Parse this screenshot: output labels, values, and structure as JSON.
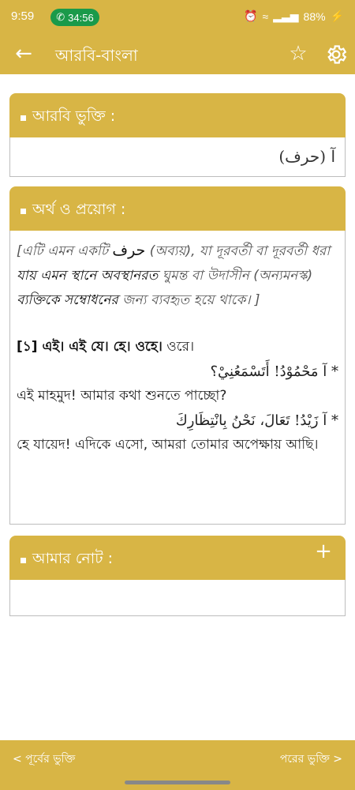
{
  "status": {
    "time": "9:59",
    "call_time": "34:56",
    "battery": "88%"
  },
  "appbar": {
    "title": "আরবি-বাংলা",
    "back_icon": "arrow-left",
    "star_icon": "star-outline",
    "settings_icon": "gear"
  },
  "arabic_card": {
    "header": "আরবি ভুক্তি :",
    "word": "آ (حرف)"
  },
  "meaning_card": {
    "header": "অর্থ ও প্রয়োগ :",
    "intro_prefix": "[এটি এমন একটি ",
    "intro_arabic": "حرف",
    "intro_mid1": " (অব্যয়), যা দূরবর্তী বা দূরবর্তী ধরা ",
    "intro_bold1": "যায় এমন স্থানে অবস্থানরত",
    "intro_mid2": " ঘুমন্ত বা উদাসীন (অন্যমনস্ক) ",
    "intro_bold2": "ব্যক্তিকে সম্বোধনের",
    "intro_suffix": " জন্য ব্যবহৃত হয়ে থাকে। ]",
    "line1_a": "[১] এই। এই যে। হে। ",
    "line1_bold": "ওহে।",
    "line1_b": " ওরে।",
    "ex1_ar": "* آ مَحْمُوْدُ! أَتَسْمَعُنِيْ؟",
    "ex1_bn": "এই মাহমুদ! আমার কথা শুনতে পাচ্ছো?",
    "ex2_ar": "* آ زَيْدُ! تَعَالَ، نَحْنُ بِانْتِظَارِكَ",
    "ex2_bn": "হে যায়েদ! এদিকে এসো, আমরা তোমার অপেক্ষায় আছি।"
  },
  "notes_card": {
    "header": "আমার নোট :",
    "add_icon": "plus"
  },
  "bottombar": {
    "prev_label": "< পূর্বের ভুক্তি",
    "next_label": "পরের ভুক্তি >"
  },
  "colors": {
    "accent": "#d8b545",
    "call_green": "#1a9a4a",
    "border": "#bdbdbd"
  }
}
